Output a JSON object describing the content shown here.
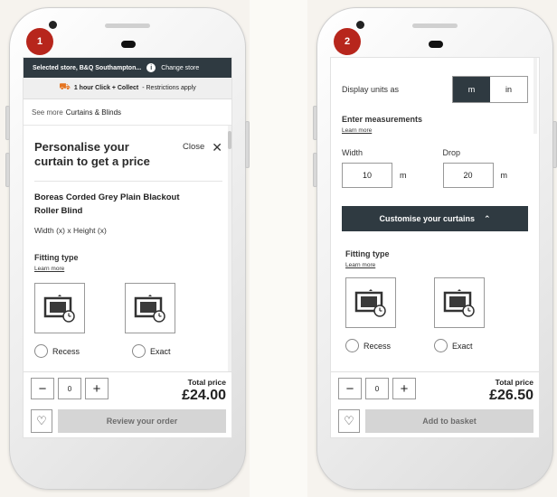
{
  "colors": {
    "dark": "#2f3a41",
    "badge": "#b7261c",
    "disabled": "#d5d5d5",
    "accent": "#e5741f"
  },
  "panel1": {
    "step": "1",
    "store_bar": {
      "label": "Selected store, B&Q Southampton...",
      "info_icon": "info-icon",
      "change": "Change store"
    },
    "click_bar": {
      "icon": "click-collect-icon",
      "bold": "1 hour Click + Collect",
      "rest": "- Restrictions apply"
    },
    "see_more": {
      "prefix": "See more",
      "category": "Curtains & Blinds"
    },
    "modal": {
      "title": "Personalise your curtain to get a price",
      "close": "Close",
      "product": "Boreas Corded Grey Plain Blackout Roller Blind",
      "dims": "Width (x) x Height (x)",
      "fitting_label": "Fitting type",
      "learn_more": "Learn more",
      "options": [
        "Recess",
        "Exact"
      ]
    },
    "bottom": {
      "qty": "0",
      "price_label": "Total price",
      "price": "£24.00",
      "cta": "Review your order"
    }
  },
  "panel2": {
    "step": "2",
    "units_label": "Display units as",
    "units": [
      "m",
      "in"
    ],
    "enter_label": "Enter measurements",
    "learn_more": "Learn more",
    "width_label": "Width",
    "width_value": "10",
    "drop_label": "Drop",
    "drop_value": "20",
    "unit_suffix": "m",
    "customise": "Customise your curtains",
    "fitting_label": "Fitting type",
    "fit_learn_more": "Learn more",
    "options": [
      "Recess",
      "Exact"
    ],
    "bottom": {
      "qty": "0",
      "price_label": "Total price",
      "price": "£26.50",
      "cta": "Add to basket"
    }
  }
}
